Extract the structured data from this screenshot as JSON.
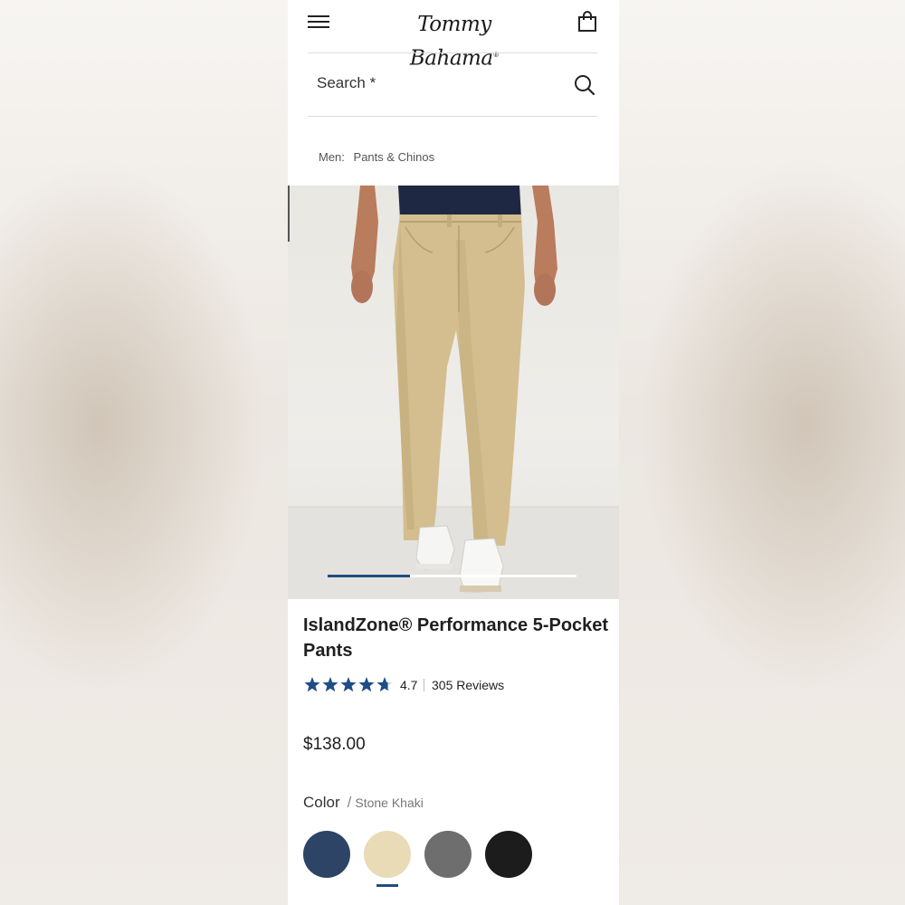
{
  "header": {
    "brand": "Tommy Bahama",
    "brand_mark": "®",
    "menu_icon": "hamburger-menu-icon",
    "bag_icon": "shopping-bag-icon"
  },
  "search": {
    "label": "Search *",
    "icon": "search-icon"
  },
  "breadcrumb": {
    "prefix": "Men:",
    "link": "Pants & Chinos"
  },
  "gallery": {
    "image_alt": "Model wearing khaki 5-pocket pants with white sneakers",
    "progress": 0.33
  },
  "product": {
    "title": "IslandZone® Performance 5-Pocket Pants",
    "rating": "4.7",
    "rating_stars": 4.7,
    "reviews": "305 Reviews",
    "price": "$138.00",
    "color_label": "Color",
    "color_separator": "/",
    "selected_color": "Stone Khaki",
    "swatches": [
      {
        "color": "#2d4467"
      },
      {
        "color": "#e8dbb6"
      },
      {
        "color": "#6e6e6e"
      },
      {
        "color": "#1c1c1c"
      }
    ],
    "selected_swatch_index": 1
  },
  "colors": {
    "accent": "#1f4d87",
    "star": "#1f4d87",
    "text": "#1f1f1f"
  }
}
